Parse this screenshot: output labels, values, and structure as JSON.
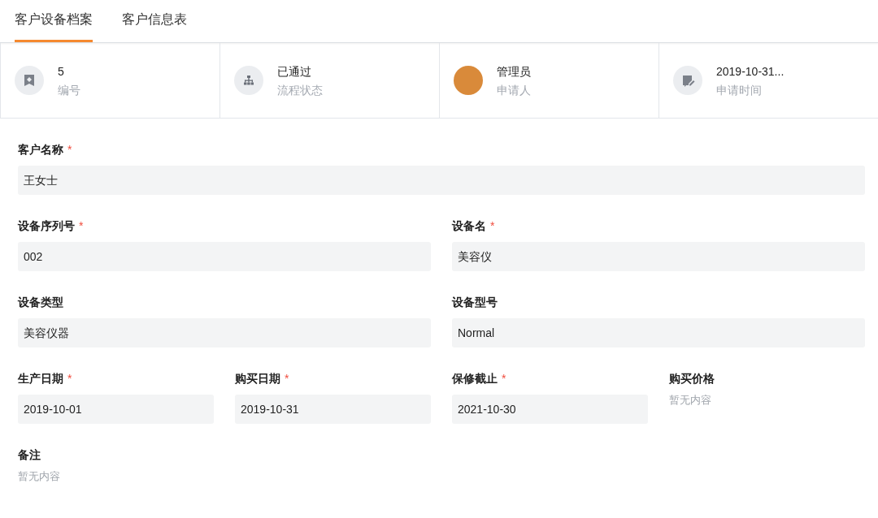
{
  "tabs": [
    {
      "label": "客户设备档案",
      "selected": true
    },
    {
      "label": "客户信息表",
      "selected": false
    }
  ],
  "summary": [
    {
      "kind": "badge",
      "value": "5",
      "label": "编号"
    },
    {
      "kind": "flow",
      "value": "已通过",
      "label": "流程状态"
    },
    {
      "kind": "avatar",
      "value": "管理员",
      "label": "申请人"
    },
    {
      "kind": "edit",
      "value": "2019-10-31...",
      "label": "申请时间"
    }
  ],
  "form_rows": [
    [
      {
        "label": "客户名称",
        "required_mark": "*",
        "kind": "field",
        "value": "王女士"
      }
    ],
    [
      {
        "label": "设备序列号",
        "required_mark": "*",
        "kind": "field",
        "value": "002"
      },
      {
        "label": "设备名",
        "required_mark": "*",
        "kind": "field",
        "value": "美容仪"
      }
    ],
    [
      {
        "label": "设备类型",
        "kind": "field",
        "value": "美容仪器"
      },
      {
        "label": "设备型号",
        "kind": "field",
        "value": "Normal"
      }
    ],
    [
      {
        "label": "生产日期",
        "required_mark": "*",
        "kind": "field",
        "value": "2019-10-01"
      },
      {
        "label": "购买日期",
        "required_mark": "*",
        "kind": "field",
        "value": "2019-10-31"
      },
      {
        "label": "保修截止",
        "required_mark": "*",
        "kind": "field",
        "value": "2021-10-30"
      },
      {
        "label": "购买价格",
        "kind": "empty",
        "value": "暂无内容"
      }
    ],
    [
      {
        "label": "备注",
        "kind": "empty",
        "value": "暂无内容"
      }
    ]
  ]
}
